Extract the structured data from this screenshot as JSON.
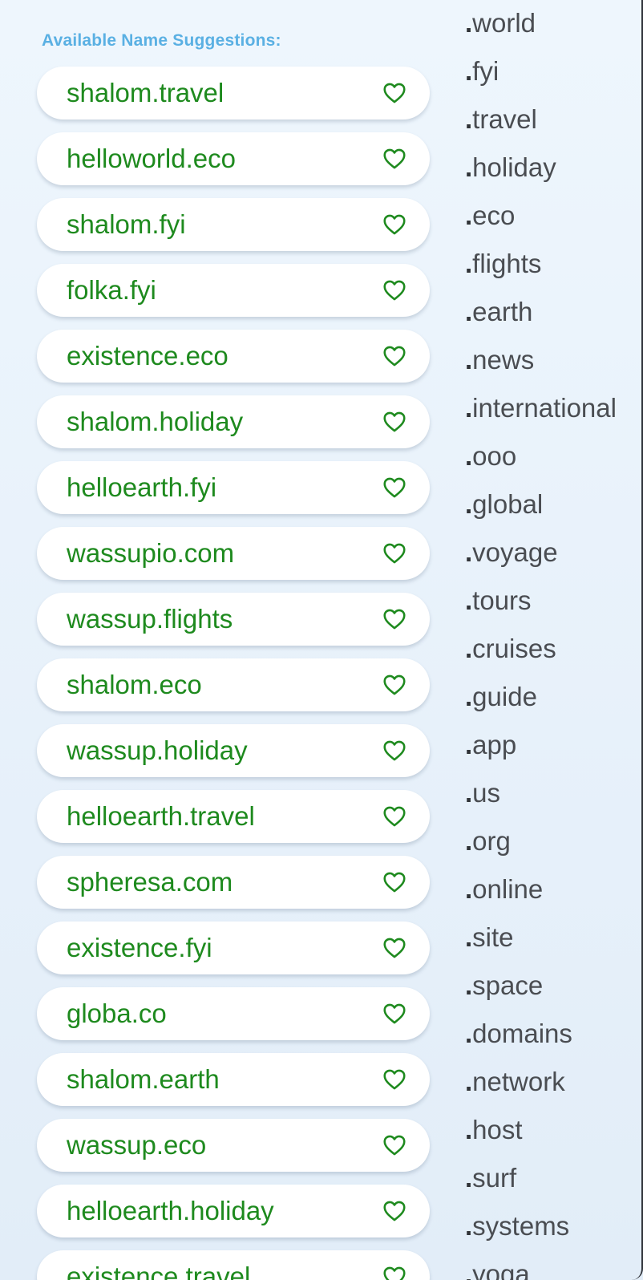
{
  "heading": "Available Name Suggestions:",
  "colors": {
    "heading": "#5ab0e3",
    "suggestion_text": "#1e8a1e",
    "heart": "#1e8a1e",
    "tld_text": "#4a4d52"
  },
  "suggestions": [
    {
      "name": "shalom.travel",
      "icon": "heart-outline-icon"
    },
    {
      "name": "helloworld.eco",
      "icon": "heart-outline-icon"
    },
    {
      "name": "shalom.fyi",
      "icon": "heart-outline-icon"
    },
    {
      "name": "folka.fyi",
      "icon": "heart-outline-icon"
    },
    {
      "name": "existence.eco",
      "icon": "heart-outline-icon"
    },
    {
      "name": "shalom.holiday",
      "icon": "heart-outline-icon"
    },
    {
      "name": "helloearth.fyi",
      "icon": "heart-outline-icon"
    },
    {
      "name": "wassupio.com",
      "icon": "heart-outline-icon"
    },
    {
      "name": "wassup.flights",
      "icon": "heart-outline-icon"
    },
    {
      "name": "shalom.eco",
      "icon": "heart-outline-icon"
    },
    {
      "name": "wassup.holiday",
      "icon": "heart-outline-icon"
    },
    {
      "name": "helloearth.travel",
      "icon": "heart-outline-icon"
    },
    {
      "name": "spheresa.com",
      "icon": "heart-outline-icon"
    },
    {
      "name": "existence.fyi",
      "icon": "heart-outline-icon"
    },
    {
      "name": "globa.co",
      "icon": "heart-outline-icon"
    },
    {
      "name": "shalom.earth",
      "icon": "heart-outline-icon"
    },
    {
      "name": "wassup.eco",
      "icon": "heart-outline-icon"
    },
    {
      "name": "helloearth.holiday",
      "icon": "heart-outline-icon"
    },
    {
      "name": "existence.travel",
      "icon": "heart-outline-icon"
    }
  ],
  "tlds": [
    "world",
    "fyi",
    "travel",
    "holiday",
    "eco",
    "flights",
    "earth",
    "news",
    "international",
    "ooo",
    "global",
    "voyage",
    "tours",
    "cruises",
    "guide",
    "app",
    "us",
    "org",
    "online",
    "site",
    "space",
    "domains",
    "network",
    "host",
    "surf",
    "systems",
    "yoga"
  ]
}
